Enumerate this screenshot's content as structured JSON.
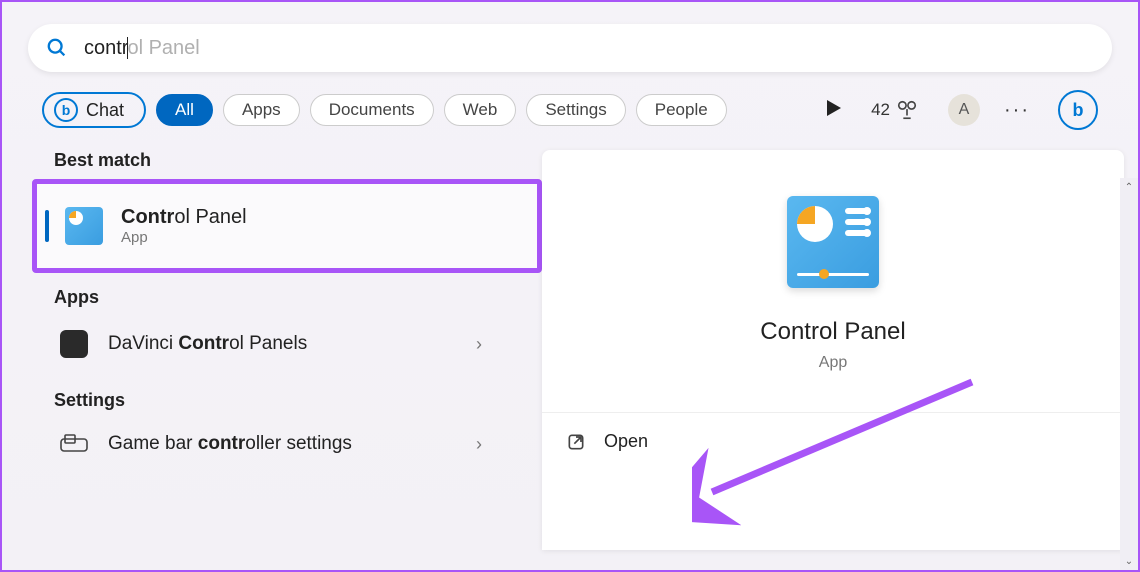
{
  "search": {
    "typed": "contr",
    "hint": "ol Panel"
  },
  "filters": {
    "chat": "Chat",
    "all": "All",
    "apps": "Apps",
    "documents": "Documents",
    "web": "Web",
    "settings": "Settings",
    "people": "People"
  },
  "header": {
    "rewards": "42",
    "avatar_letter": "A"
  },
  "left": {
    "best_match_label": "Best match",
    "best_match": {
      "title_bold": "Contr",
      "title_rest": "ol Panel",
      "subtitle": "App"
    },
    "apps_label": "Apps",
    "apps": [
      {
        "prefix": "DaVinci ",
        "bold": "Contr",
        "suffix": "ol Panels"
      }
    ],
    "settings_label": "Settings",
    "settings": [
      {
        "prefix": "Game bar ",
        "bold": "contr",
        "suffix": "oller settings"
      }
    ]
  },
  "right": {
    "title": "Control Panel",
    "subtitle": "App",
    "open_label": "Open"
  }
}
